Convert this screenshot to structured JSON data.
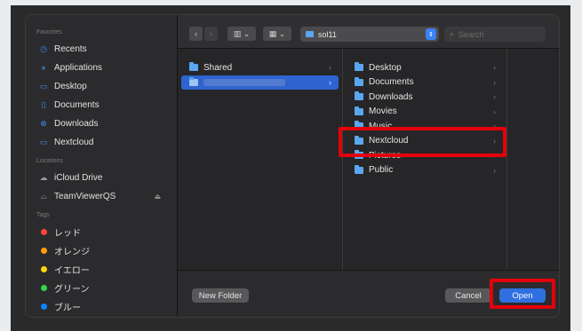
{
  "sidebar": {
    "favorites_title": "Favorites",
    "favorites": [
      {
        "label": "Recents",
        "icon": "clock-icon"
      },
      {
        "label": "Applications",
        "icon": "applications-icon"
      },
      {
        "label": "Desktop",
        "icon": "desktop-icon"
      },
      {
        "label": "Documents",
        "icon": "document-icon"
      },
      {
        "label": "Downloads",
        "icon": "download-icon"
      },
      {
        "label": "Nextcloud",
        "icon": "folder-icon"
      }
    ],
    "locations_title": "Locations",
    "locations": [
      {
        "label": "iCloud Drive",
        "icon": "cloud-icon"
      },
      {
        "label": "TeamViewerQS",
        "icon": "drive-icon"
      }
    ],
    "tags_title": "Tags",
    "tags": [
      {
        "label": "レッド",
        "color": "#ff453a"
      },
      {
        "label": "オレンジ",
        "color": "#ff9f0a"
      },
      {
        "label": "イエロー",
        "color": "#ffd60a"
      },
      {
        "label": "グリーン",
        "color": "#32d74b"
      },
      {
        "label": "ブルー",
        "color": "#0a84ff"
      }
    ]
  },
  "toolbar": {
    "path_label": "sol11",
    "search_placeholder": "Search"
  },
  "columns": {
    "col1": [
      {
        "label": "Shared",
        "selected": false
      },
      {
        "label": "",
        "selected": true
      }
    ],
    "col2": [
      {
        "label": "Desktop"
      },
      {
        "label": "Documents"
      },
      {
        "label": "Downloads"
      },
      {
        "label": "Movies"
      },
      {
        "label": "Music"
      },
      {
        "label": "Nextcloud"
      },
      {
        "label": "Pictures"
      },
      {
        "label": "Public"
      }
    ]
  },
  "buttons": {
    "new_folder": "New Folder",
    "cancel": "Cancel",
    "open": "Open"
  },
  "colors": {
    "accent": "#2f6fe0",
    "highlight": "#e3000a"
  }
}
